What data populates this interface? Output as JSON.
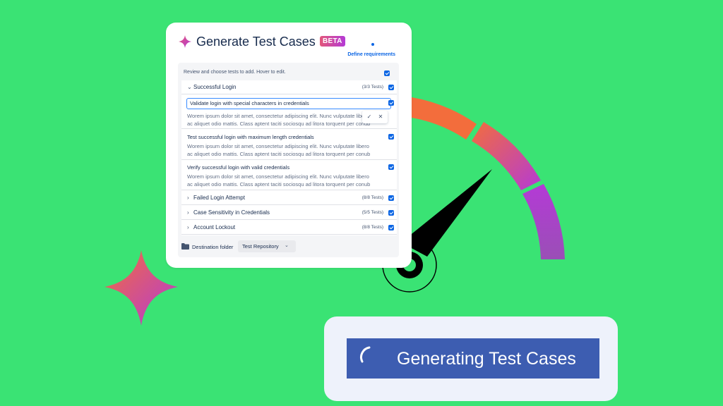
{
  "dialog": {
    "title": "Generate Test Cases",
    "badge": "BETA",
    "define_link": "Define requirements",
    "instructions": "Review and choose tests to add. Hover to edit.",
    "groups": [
      {
        "label": "Successful Login",
        "count": "(3/3 Tests)",
        "expanded": true
      },
      {
        "label": "Failed Login Attempt",
        "count": "(8/8 Tests)",
        "expanded": false
      },
      {
        "label": "Case Sensitivity in Credentials",
        "count": "(5/5 Tests)",
        "expanded": false
      },
      {
        "label": "Account Lockout",
        "count": "(8/8 Tests)",
        "expanded": false
      }
    ],
    "tests": [
      {
        "title": "Validate login with special characters in credentials",
        "line1": "Worem ipsum dolor sit amet, consectetur adipiscing elit. Nunc vulputate libero",
        "line2": "ac aliquet odio mattis. Class aptent taciti sociosqu ad litora torquent per conub",
        "editing": true
      },
      {
        "title": "Test successful login with maximum length credentials",
        "line1": "Worem ipsum dolor sit amet, consectetur adipiscing elit. Nunc vulputate libero",
        "line2": "ac aliquet odio mattis. Class aptent taciti sociosqu ad litora torquent per conub",
        "editing": false
      },
      {
        "title": "Verify successful login with valid credentials",
        "line1": "Worem ipsum dolor sit amet, consectetur adipiscing elit. Nunc vulputate libero",
        "line2": "ac aliquet odio mattis. Class aptent taciti sociosqu ad litora torquent per conub",
        "editing": false
      }
    ],
    "edit_actions": {
      "confirm_icon": "check-icon",
      "cancel_icon": "close-icon"
    },
    "footer": {
      "label": "Destination folder",
      "select_value": "Test Repository"
    }
  },
  "status": {
    "label": "Generating Test Cases",
    "icon": "spinner-icon"
  },
  "colors": {
    "background": "#3ae374",
    "accent": "#0c66e4",
    "button": "#3d5db1",
    "gradient_start": "#f36d3c",
    "gradient_end": "#b43ad6"
  }
}
